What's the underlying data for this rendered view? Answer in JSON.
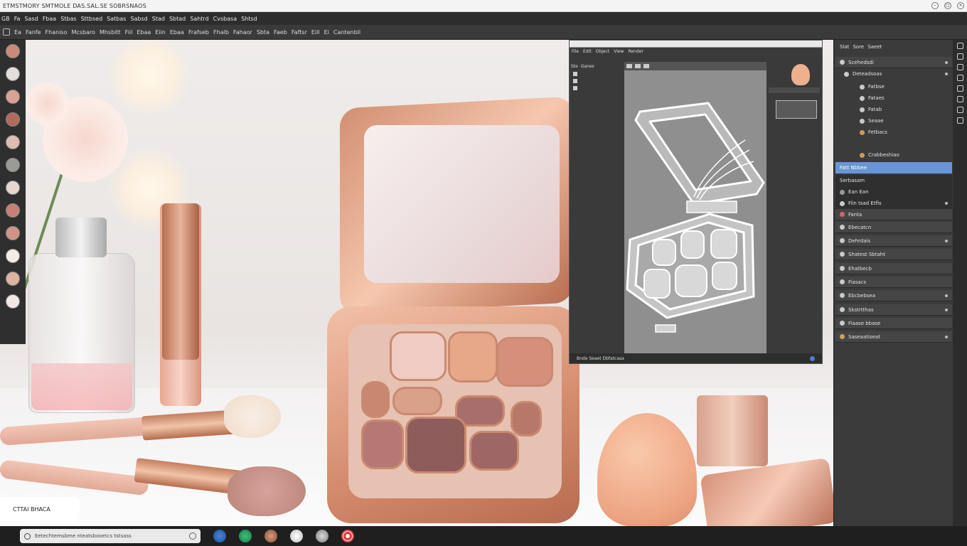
{
  "window": {
    "title": "ETMSTMORY SMTMOLE DAS.SAL.SE SOBRSNAOS"
  },
  "menubar": {
    "items": [
      "GB",
      "Fa",
      "Sasd",
      "Fbaa",
      "Stbas",
      "Sttbsed",
      "Satbas",
      "Sabsd",
      "Stad",
      "Sbtad",
      "Sahtrd",
      "Cvsbasa",
      "Shtsd"
    ]
  },
  "toolbar": {
    "items": [
      "Ea",
      "Fanfe",
      "Fhaniso",
      "Mcsbaro",
      "Mhsbitt",
      "Fiil",
      "Ebaa",
      "Eiin",
      "Ebaa",
      "Frafseb",
      "Fhalb",
      "Fahaor",
      "Sbta",
      "Faeb",
      "Faftsr",
      "Eill",
      "Ei",
      "Cantenbll"
    ]
  },
  "canvas_caption": "CTTAI BHACA",
  "viewport": {
    "menu": [
      "File",
      "Edit",
      "Object",
      "View",
      "Render"
    ],
    "head": [
      "Ste",
      "Ganes"
    ],
    "status": "Bnde Seaet  Dbfatcasa"
  },
  "right_panel": {
    "header": [
      "Slat",
      "Sore",
      "Saeet"
    ],
    "rows": [
      {
        "label": "Scehedsdi",
        "kind": "plain"
      },
      {
        "label": "Deteadsoas",
        "kind": "plain"
      },
      {
        "label": "Fatbse",
        "kind": "plain"
      },
      {
        "label": "Fataes",
        "kind": "plain"
      },
      {
        "label": "Fatab",
        "kind": "plain"
      },
      {
        "label": "Seaae",
        "kind": "plain"
      },
      {
        "label": "Fetbacs",
        "kind": "plain"
      },
      {
        "label": "Crabbeshiao",
        "kind": "plain"
      },
      {
        "label": "Fatt Nbbee",
        "kind": "selected"
      },
      {
        "label": "Serbasam",
        "kind": "dark"
      },
      {
        "label": "Ean Ean",
        "kind": "dark"
      },
      {
        "label": "Fiin tsad  Etfis",
        "kind": "dark"
      },
      {
        "label": "Fanta",
        "kind": "box"
      },
      {
        "label": "Ebecatcn",
        "kind": "box"
      },
      {
        "label": "Dehrdais",
        "kind": "box"
      },
      {
        "label": "Shatest Sbtaht",
        "kind": "box"
      },
      {
        "label": "Ehatbecb",
        "kind": "box"
      },
      {
        "label": "Fiasacs",
        "kind": "box"
      },
      {
        "label": "Ebcbebsea",
        "kind": "box"
      },
      {
        "label": "Skstrtthas",
        "kind": "box"
      },
      {
        "label": "Fiaase bbase",
        "kind": "box"
      },
      {
        "label": "Saseaatiseat",
        "kind": "box"
      }
    ]
  },
  "taskbar": {
    "search_text": "Eetechtemsbme nteatsbooetcs tstsass"
  },
  "colors": {
    "accent": "#6a95d8",
    "panel": "#3b3b3b",
    "rose_gold": "#d48a6c"
  }
}
